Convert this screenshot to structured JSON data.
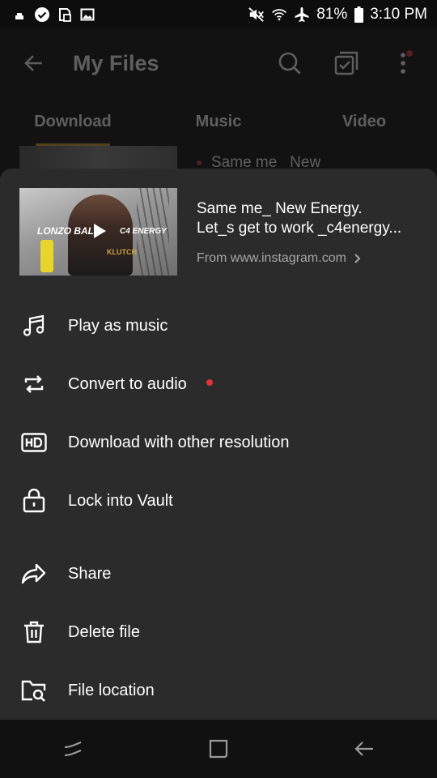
{
  "status_bar": {
    "battery": "81%",
    "time": "3:10 PM",
    "left_icons": [
      "notification-icon",
      "check-circle-icon",
      "screenshot-icon",
      "gallery-icon"
    ],
    "right_icons": [
      "mute-icon",
      "wifi-icon",
      "airplane-icon",
      "battery-icon"
    ]
  },
  "app_bar": {
    "title": "My Files"
  },
  "tabs": [
    {
      "label": "Download",
      "active": true
    },
    {
      "label": "Music",
      "active": false
    },
    {
      "label": "Video",
      "active": false
    }
  ],
  "background_item": {
    "text": "Same me_ New"
  },
  "sheet": {
    "file": {
      "title_line1": "Same me_ New Energy.",
      "title_line2": "Let_s get to work _c4energy...",
      "source": "From www.instagram.com",
      "thumbnail_text_left": "LONZO BALL",
      "thumbnail_text_right": "C4 ENERGY",
      "thumbnail_shirt": "KLUTCH"
    },
    "menu": [
      {
        "label": "Play as music",
        "icon": "music-note-icon"
      },
      {
        "label": "Convert to audio",
        "icon": "convert-icon",
        "badge_dot": true
      },
      {
        "label": "Download with other resolution",
        "icon": "hd-icon"
      },
      {
        "label": "Lock into Vault",
        "icon": "lock-icon"
      },
      {
        "label": "Share",
        "icon": "share-icon"
      },
      {
        "label": "Delete file",
        "icon": "trash-icon"
      },
      {
        "label": "File location",
        "icon": "folder-search-icon"
      }
    ]
  },
  "colors": {
    "accent": "#d7a43a",
    "badge": "#e0323d",
    "sheet_bg": "#2b2b2b"
  }
}
